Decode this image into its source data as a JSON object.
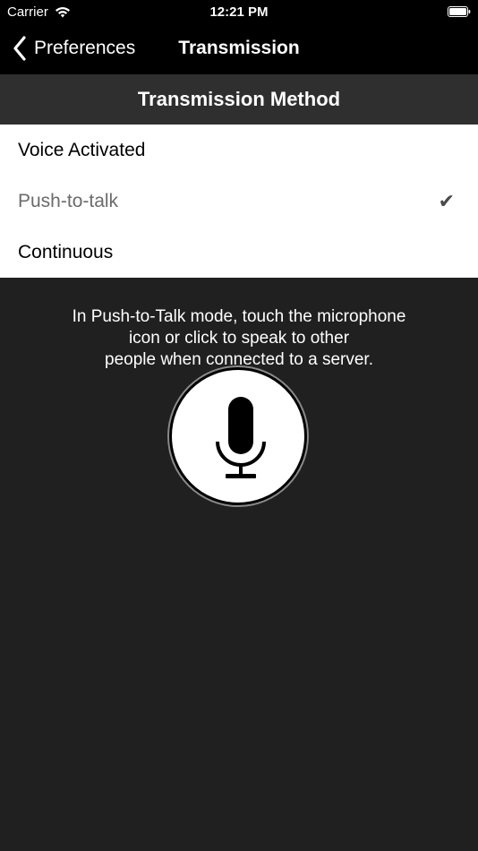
{
  "status_bar": {
    "carrier": "Carrier",
    "time": "12:21 PM"
  },
  "nav": {
    "back_label": "Preferences",
    "title": "Transmission"
  },
  "section": {
    "header": "Transmission Method"
  },
  "options": [
    {
      "label": "Voice Activated",
      "selected": false
    },
    {
      "label": "Push-to-talk",
      "selected": true
    },
    {
      "label": "Continuous",
      "selected": false
    }
  ],
  "check_glyph": "✔",
  "description": "In Push-to-Talk mode, touch the microphone\nicon or click to speak to other\npeople when connected to a server.",
  "icons": {
    "wifi": "wifi-icon",
    "battery": "battery-icon",
    "back": "chevron-left-icon",
    "check": "checkmark-icon",
    "mic": "microphone-icon"
  },
  "colors": {
    "background": "#202020",
    "bar": "#000000",
    "section_header": "#2f2f2f",
    "list_background": "#ffffff"
  }
}
